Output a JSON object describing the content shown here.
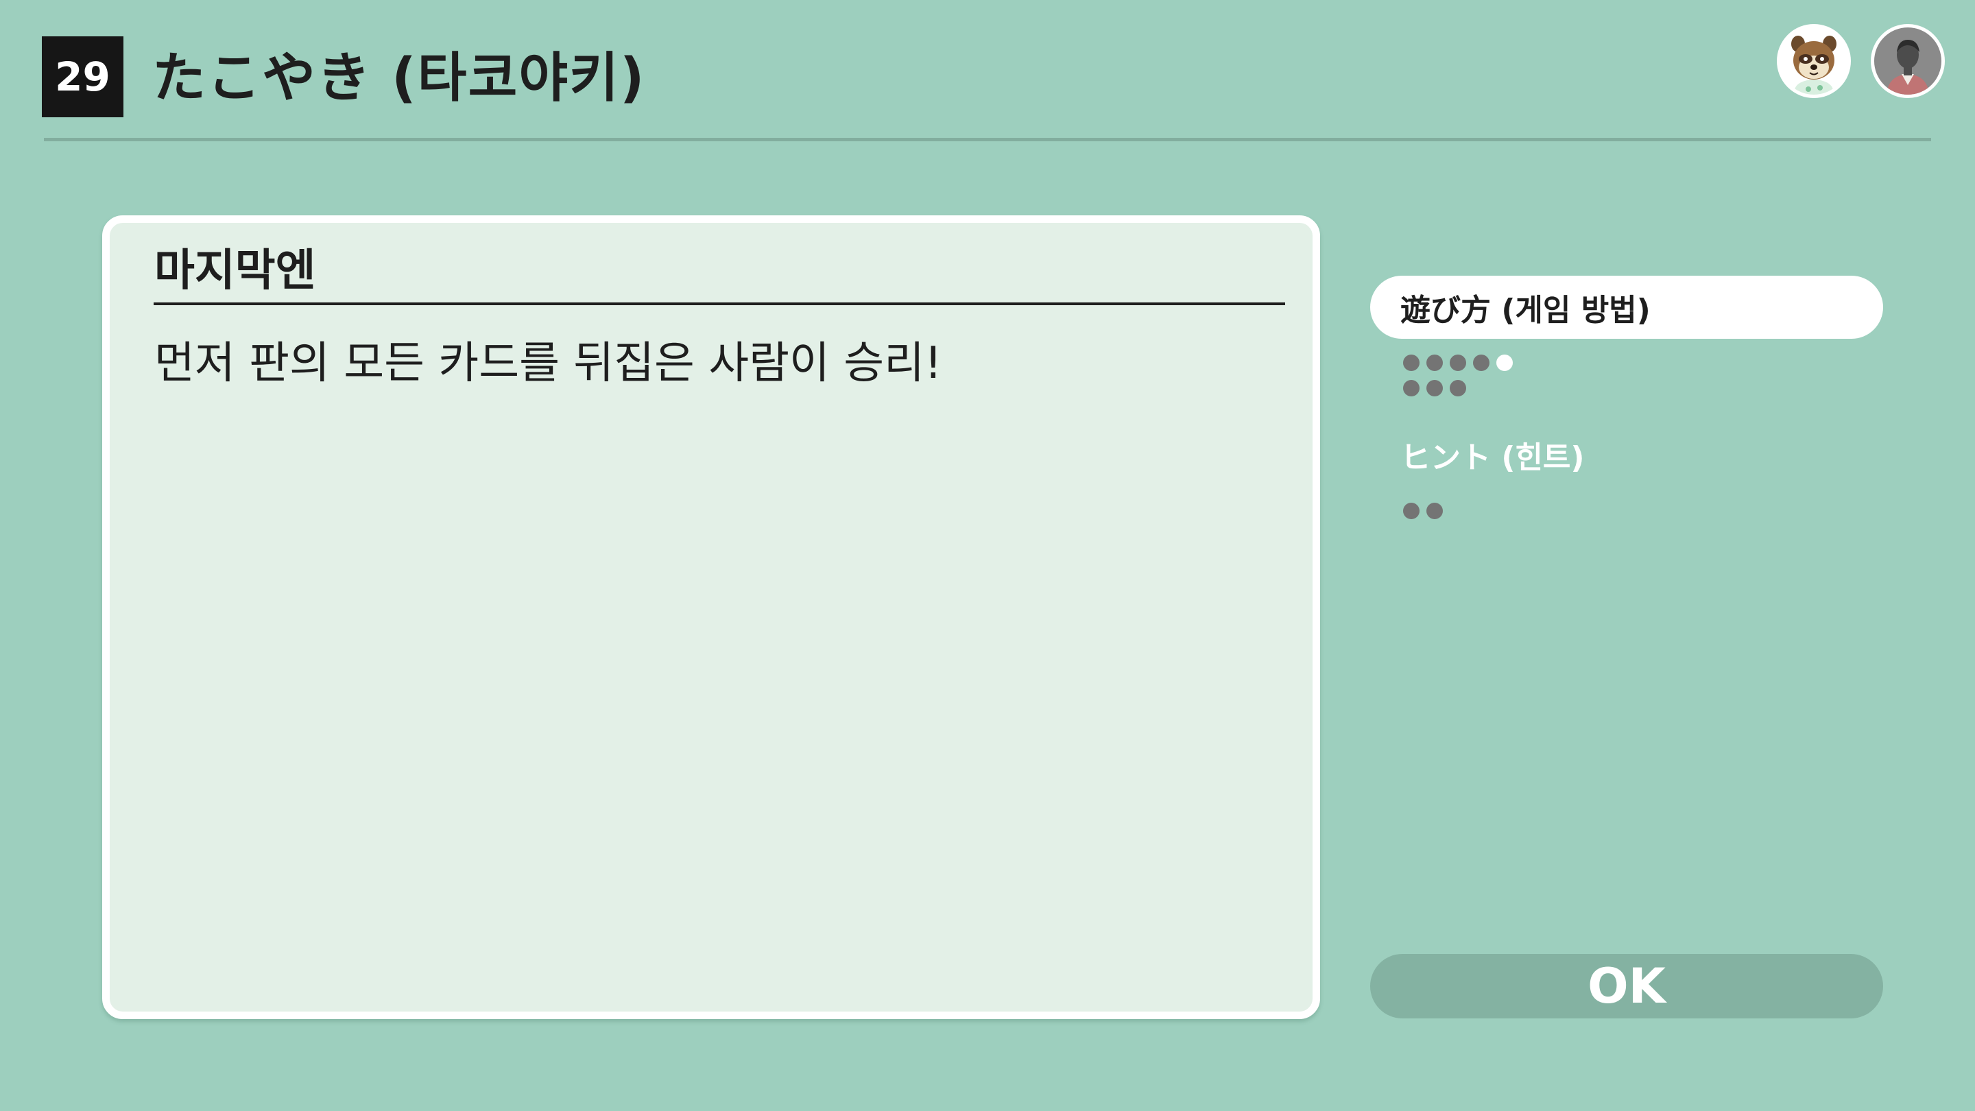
{
  "header": {
    "game_number": "29",
    "title": "たこやき (타코야키)"
  },
  "card": {
    "heading": "마지막엔",
    "body": "먼저 판의 모든 카드를 뒤집은 사람이 승리!"
  },
  "menu": {
    "items": [
      {
        "label": "遊び方 (게임 방법)",
        "pages": 8,
        "current_page": 5
      },
      {
        "label": "ヒント (힌트)",
        "pages": 2,
        "current_page": null
      }
    ]
  },
  "ok_button": {
    "label": "OK"
  },
  "avatars": [
    "raccoon-character-avatar",
    "user-avatar"
  ],
  "colors": {
    "background": "#9dcfbe",
    "card": "#e3f0e7",
    "ok_button": "#84b2a2",
    "dot": "#747474"
  }
}
